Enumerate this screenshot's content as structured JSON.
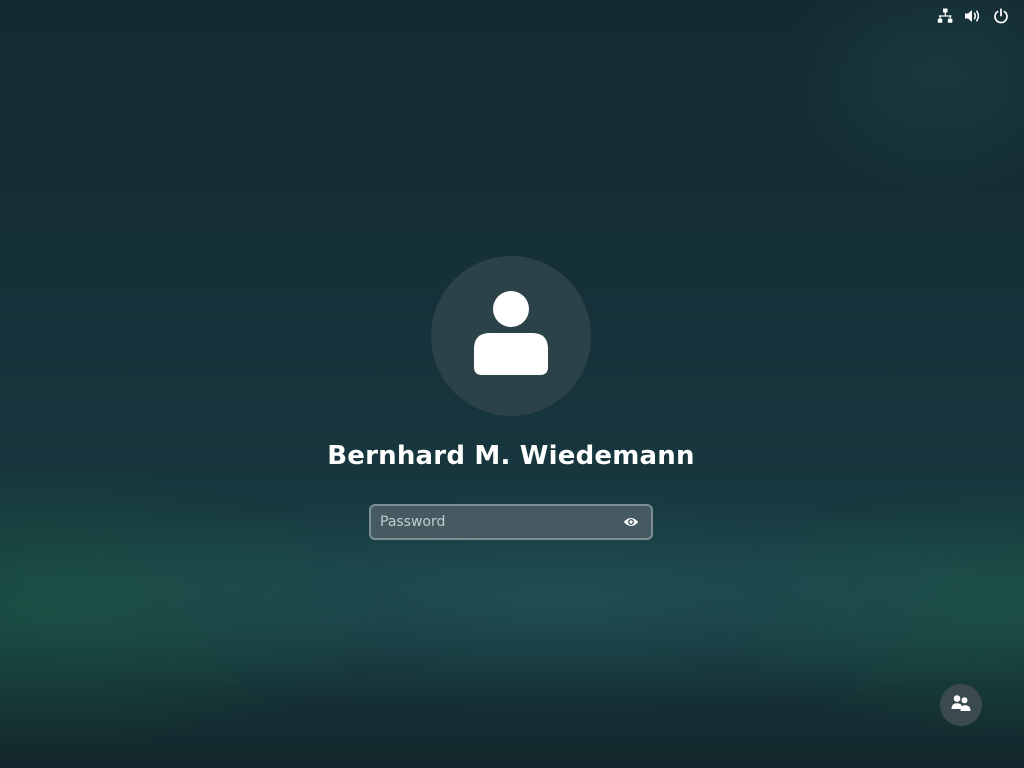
{
  "system_tray": {
    "icons": [
      "network-wired-icon",
      "volume-icon",
      "power-icon"
    ]
  },
  "user": {
    "display_name": "Bernhard M. Wiedemann",
    "avatar_icon": "user-avatar-icon"
  },
  "password": {
    "placeholder": "Password",
    "value": "",
    "reveal_icon": "eye-icon"
  },
  "bottom_actions": {
    "switch_user_icon": "switch-user-icon"
  },
  "colors": {
    "background": "#17323a",
    "avatar_bg": "#2c4249",
    "field_bg": "#465b61",
    "field_border": "#7d8e93",
    "switch_button_bg": "#3b4a4f",
    "text": "#ffffff"
  }
}
